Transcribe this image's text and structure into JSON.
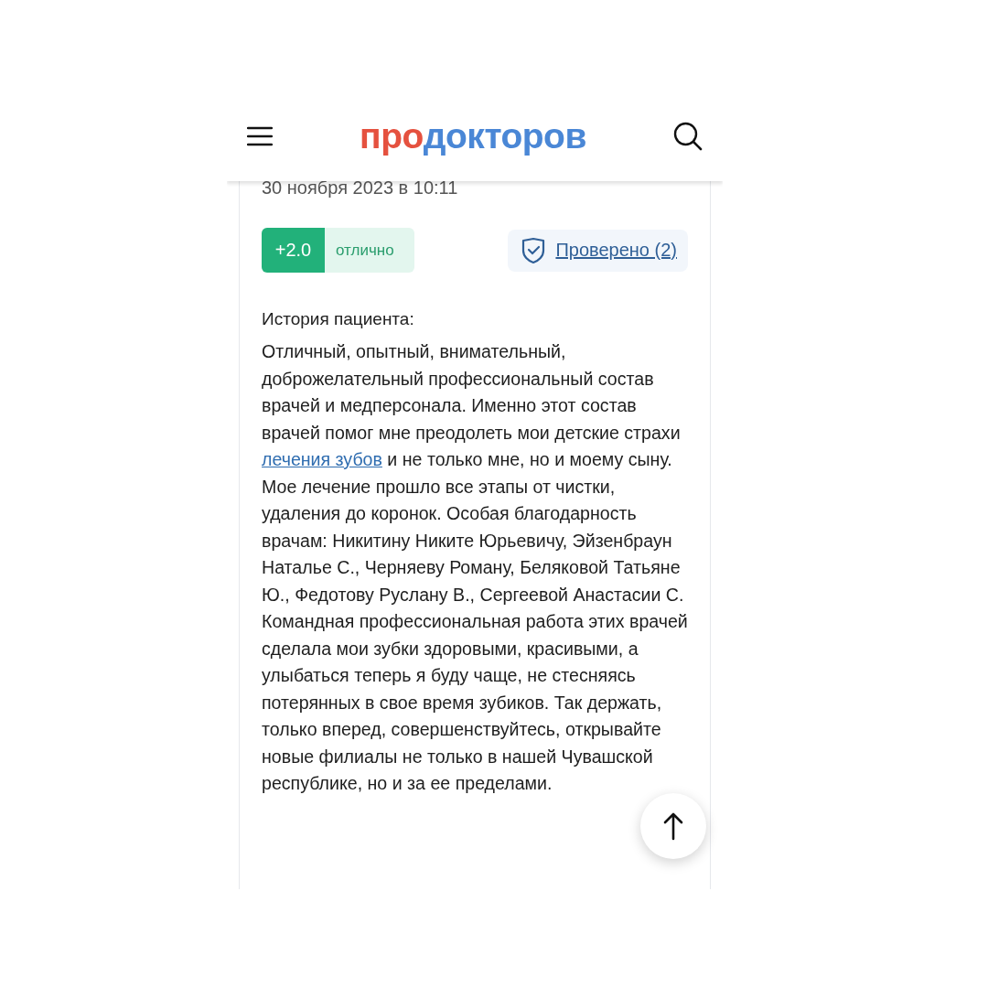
{
  "header": {
    "logo": [
      {
        "text": "про",
        "color": "#e5513f"
      },
      {
        "text": "докторов",
        "color": "#4a87d6"
      }
    ]
  },
  "review": {
    "date": "30 ноября 2023 в 10:11",
    "score": "+2.0",
    "score_label": "отлично",
    "verified": "Проверено (2)",
    "story_title": "История пациента:",
    "story": [
      {
        "kind": "text",
        "text": "Отличный, опытный, внимательный, доброжелательный профессиональный состав врачей и медперсонала. Именно этот состав врачей помог мне преодолеть мои детские страхи "
      },
      {
        "kind": "link",
        "text": "лечения зубов"
      },
      {
        "kind": "text",
        "text": " и не только мне, но и моему сыну. Мое лечение прошло все этапы от чистки, удаления до коронок. Особая благодарность врачам: Никитину Никите Юрьевичу, Эйзенбраун Наталье С., Черняеву Роману, Беляковой Татьяне Ю., Федотову Руслану В., Сергеевой Анастасии С. Командная профессиональная работа этих врачей сделала мои зубки здоровыми, красивыми, а улыбаться теперь я буду чаще, не стесняясь потерянных в свое время зубиков. Так держать, только вперед, совершенствуйтесь, открывайте новые филиалы не только в нашей Чувашской республике, но и за ее пределами."
      }
    ]
  }
}
